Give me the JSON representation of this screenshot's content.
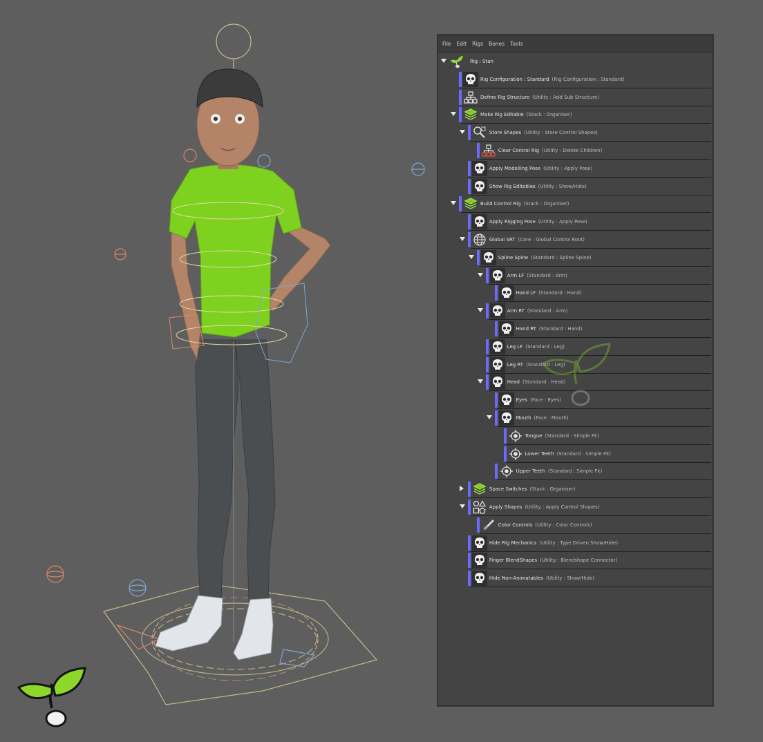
{
  "menu": [
    "File",
    "Edit",
    "Rigs",
    "Bones",
    "Tools"
  ],
  "colors": {
    "accent_bar": "#6b6bff",
    "panel_bg": "#444444",
    "viewport_bg": "#5e5e5e",
    "logo_green": "#8fd62a"
  },
  "tree": [
    {
      "name": "Rig : Stan",
      "type": "",
      "depth": 0,
      "icon": "rig-sprout-icon",
      "expander": "open"
    },
    {
      "name": "Rig Configuration : Standard",
      "type": "(Rig Configuration : Standard)",
      "depth": 1,
      "icon": "skull-icon",
      "expander": "none"
    },
    {
      "name": "Define Rig Structure",
      "type": "(Utility : Add Sub Structure)",
      "depth": 1,
      "icon": "hierarchy-icon",
      "expander": "none"
    },
    {
      "name": "Make Rig Editable",
      "type": "(Stack : Organiser)",
      "depth": 1,
      "icon": "stack-icon",
      "expander": "open"
    },
    {
      "name": "Store Shapes",
      "type": "(Utility : Store Control Shapes)",
      "depth": 2,
      "icon": "shapes-icon",
      "expander": "open"
    },
    {
      "name": "Clear Control Rig",
      "type": "(Utility : Delete Children)",
      "depth": 3,
      "icon": "hierarchy-red-icon",
      "expander": "none"
    },
    {
      "name": "Apply Modelling Pose",
      "type": "(Utility : Apply Pose)",
      "depth": 2,
      "icon": "skull-icon",
      "expander": "none"
    },
    {
      "name": "Show Rig Editables",
      "type": "(Utility : Show/Hide)",
      "depth": 2,
      "icon": "skull-icon",
      "expander": "none"
    },
    {
      "name": "Build Control Rig",
      "type": "(Stack : Organiser)",
      "depth": 1,
      "icon": "stack-icon",
      "expander": "open"
    },
    {
      "name": "Apply Rigging Pose",
      "type": "(Utility : Apply Pose)",
      "depth": 2,
      "icon": "skull-icon",
      "expander": "none"
    },
    {
      "name": "Global SRT",
      "type": "(Core : Global Control Root)",
      "depth": 2,
      "icon": "globe-icon",
      "expander": "open"
    },
    {
      "name": "Spline Spine",
      "type": "(Standard : Spline Spine)",
      "depth": 3,
      "icon": "skull-icon",
      "expander": "open"
    },
    {
      "name": "Arm LF",
      "type": "(Standard : Arm)",
      "depth": 4,
      "icon": "skull-icon",
      "expander": "open"
    },
    {
      "name": "Hand LF",
      "type": "(Standard : Hand)",
      "depth": 5,
      "icon": "skull-icon",
      "expander": "none"
    },
    {
      "name": "Arm RT",
      "type": "(Standard : Arm)",
      "depth": 4,
      "icon": "skull-icon",
      "expander": "open"
    },
    {
      "name": "Hand RT",
      "type": "(Standard : Hand)",
      "depth": 5,
      "icon": "skull-icon",
      "expander": "none"
    },
    {
      "name": "Leg LF",
      "type": "(Standard : Leg)",
      "depth": 4,
      "icon": "skull-icon",
      "expander": "none"
    },
    {
      "name": "Leg RT",
      "type": "(Standard : Leg)",
      "depth": 4,
      "icon": "skull-icon",
      "expander": "none"
    },
    {
      "name": "Head",
      "type": "(Standard : Head)",
      "depth": 4,
      "icon": "skull-icon",
      "expander": "open"
    },
    {
      "name": "Eyes",
      "type": "(Face : Eyes)",
      "depth": 5,
      "icon": "skull-icon",
      "expander": "none"
    },
    {
      "name": "Mouth",
      "type": "(Face : Mouth)",
      "depth": 5,
      "icon": "skull-icon",
      "expander": "open"
    },
    {
      "name": "Tongue",
      "type": "(Standard : Simple Fk)",
      "depth": 6,
      "icon": "target-icon",
      "expander": "none"
    },
    {
      "name": "Lower Teeth",
      "type": "(Standard : Simple Fk)",
      "depth": 6,
      "icon": "target-icon",
      "expander": "none"
    },
    {
      "name": "Upper Teeth",
      "type": "(Standard : Simple Fk)",
      "depth": 5,
      "icon": "target-icon",
      "expander": "none"
    },
    {
      "name": "Space Switches",
      "type": "(Stack : Organiser)",
      "depth": 2,
      "icon": "stack-icon",
      "expander": "closed"
    },
    {
      "name": "Apply Shapes",
      "type": "(Utility : Apply Control Shapes)",
      "depth": 2,
      "icon": "shapes-apply-icon",
      "expander": "open"
    },
    {
      "name": "Color Controls",
      "type": "(Utility : Color Controls)",
      "depth": 3,
      "icon": "brush-icon",
      "expander": "none"
    },
    {
      "name": "Hide Rig Mechanics",
      "type": "(Utility : Type Driven Show/Hide)",
      "depth": 2,
      "icon": "skull-icon",
      "expander": "none"
    },
    {
      "name": "Finger BlendShapes",
      "type": "(Utility : Blendshape Connector)",
      "depth": 2,
      "icon": "skull-icon",
      "expander": "none"
    },
    {
      "name": "Hide Non-Animatables",
      "type": "(Utility : Show/Hide)",
      "depth": 2,
      "icon": "skull-icon",
      "expander": "none"
    }
  ]
}
